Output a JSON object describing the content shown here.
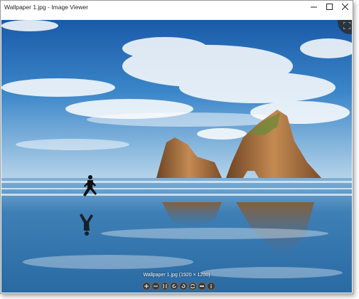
{
  "window": {
    "title": "Wallpaper 1.jpg - Image Viewer",
    "controls": [
      "minimize",
      "maximize",
      "close"
    ]
  },
  "viewer": {
    "caption": "Wallpaper 1.jpg (1920 × 1200)",
    "toolbar": [
      {
        "name": "zoom-in",
        "icon": "plus-icon"
      },
      {
        "name": "zoom-out",
        "icon": "minus-icon"
      },
      {
        "name": "actual-size",
        "icon": "one-to-one-icon"
      },
      {
        "name": "previous",
        "icon": "rotate-left-icon"
      },
      {
        "name": "next",
        "icon": "rotate-right-icon"
      },
      {
        "name": "fit",
        "icon": "fit-icon"
      },
      {
        "name": "delete",
        "icon": "delete-icon"
      },
      {
        "name": "info",
        "icon": "info-icon"
      }
    ]
  },
  "colors": {
    "sky_top": "#1c5fae",
    "sky_bottom": "#9cc7e6",
    "rock": "#a56a3a",
    "sea": "#2c6fa6"
  }
}
